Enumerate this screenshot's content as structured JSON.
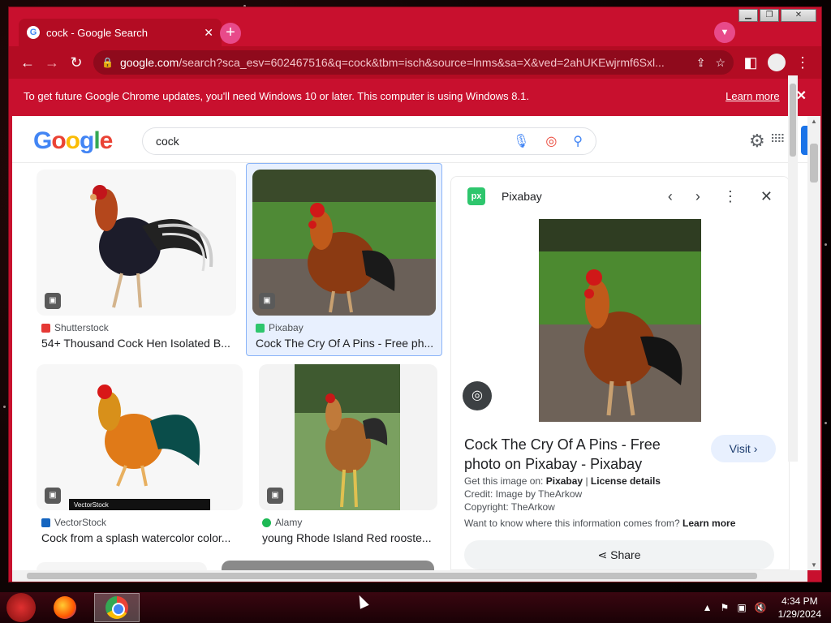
{
  "window": {
    "minimize": "▁",
    "maximize": "❐",
    "close": "✕"
  },
  "tab": {
    "favicon": "G",
    "title": "cock - Google Search",
    "close": "✕"
  },
  "toolbar": {
    "url_domain": "google.com",
    "url_rest": "/search?sca_esv=602467516&q=cock&tbm=isch&source=lnms&sa=X&ved=2ahUKEwjrmf6Sxl..."
  },
  "infobar": {
    "message": "To get future Google Chrome updates, you'll need Windows 10 or later. This computer is using Windows 8.1.",
    "learn_more": "Learn more"
  },
  "google": {
    "logo": [
      "G",
      "o",
      "o",
      "g",
      "l",
      "e"
    ],
    "search_value": "cock"
  },
  "results": [
    {
      "source": "Shutterstock",
      "title": "54+ Thousand Cock Hen Isolated B...",
      "source_color": "#e53935"
    },
    {
      "source": "Pixabay",
      "title": "Cock The Cry Of A Pins - Free ph...",
      "source_color": "#2ec66d"
    },
    {
      "source": "VectorStock",
      "title": "Cock from a splash watercolor color...",
      "source_color": "#1565c0"
    },
    {
      "source": "Alamy",
      "title": "young Rhode Island Red rooste...",
      "source_color": "#1db954"
    }
  ],
  "vectorstock_watermark": "VectorStock",
  "panel": {
    "logo": "px",
    "source": "Pixabay",
    "title": "Cock The Cry Of A Pins - Free photo on Pixabay - Pixabay",
    "visit": "Visit ›",
    "get_image_label": "Get this image on:",
    "get_image_source": "Pixabay",
    "separator": "|",
    "license": "License details",
    "credit": "Credit: Image by TheArkow",
    "copyright": "Copyright: TheArkow",
    "info_question": "Want to know where this information comes from?",
    "info_learn_more": "Learn more",
    "share": "Share"
  },
  "taskbar": {
    "time": "4:34 PM",
    "date": "1/29/2024"
  }
}
